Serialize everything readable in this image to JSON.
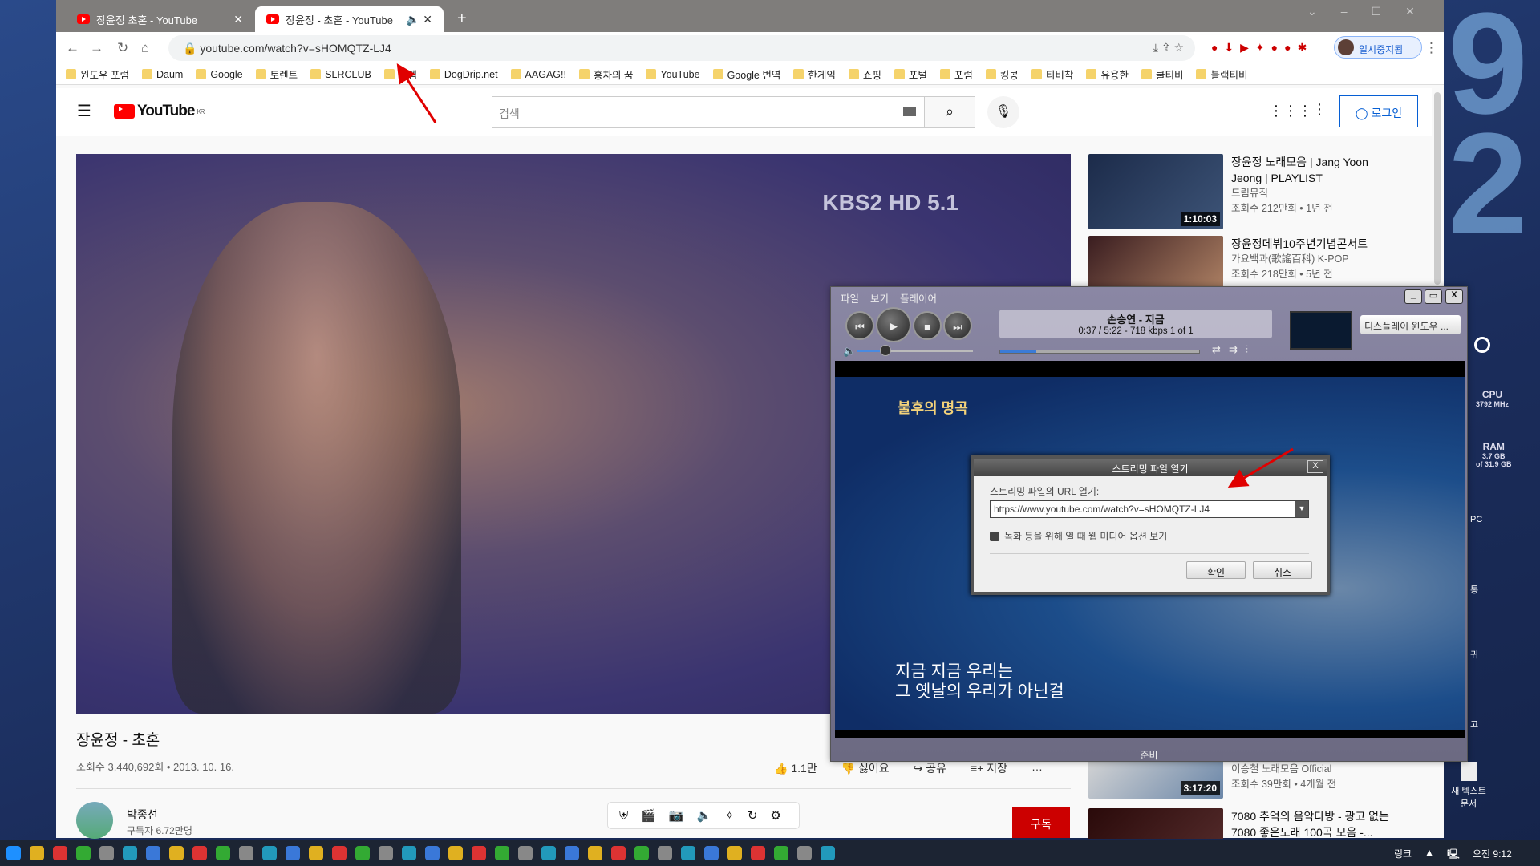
{
  "browser": {
    "tabs": [
      {
        "title": "장윤정 초혼 - YouTube"
      },
      {
        "title": "장윤정 - 초혼 - YouTube"
      }
    ],
    "url": "youtube.com/watch?v=sHOMQTZ-LJ4",
    "profile_label": "일시중지됨",
    "bookmarks": [
      "윈도우 포럼",
      "Daum",
      "Google",
      "토렌트",
      "SLRCLUB",
      "에펨",
      "DogDrip.net",
      "AAGAG!!",
      "홍차의 꿈",
      "YouTube",
      "Google 번역",
      "한게임",
      "쇼핑",
      "포털",
      "포럼",
      "킹콩",
      "티비착",
      "유용한",
      "쿨티비",
      "블랙티비"
    ]
  },
  "youtube": {
    "logo": "YouTube",
    "region": "KR",
    "search_placeholder": "검색",
    "login_label": "로그인",
    "video": {
      "title": "장윤정 - 초혼",
      "meta": "조회수 3,440,692회 • 2013. 10. 16.",
      "likes": "1.1만",
      "dislike": "싫어요",
      "share": "공유",
      "save": "저장",
      "channel": "박종선",
      "subscribers": "구독자 6.72만명",
      "subscribe": "구독",
      "watermark": "KBS2 HD 5.1"
    },
    "sidebar": [
      {
        "title": "장윤정 노래모음 | Jang Yoon Jeong | PLAYLIST",
        "channel": "드림뮤직",
        "meta": "조회수 212만회 • 1년 전",
        "duration": "1:10:03"
      },
      {
        "title": "장윤정데뷔10주년기념콘서트",
        "channel": "가요백과(歌謠百科) K-POP",
        "meta": "조회수 218만회 • 5년 전"
      },
      {
        "title": "이승철 노래모음 Official",
        "meta": "조회수 39만회 • 4개월 전",
        "duration": "3:17:20"
      },
      {
        "title": "7080 추억의 음악다방 - 광고 없는 7080 좋은노래 100곡 모음 -..."
      }
    ]
  },
  "player": {
    "menu": [
      "파일",
      "보기",
      "플레이어"
    ],
    "track": "손승연 - 지금",
    "time": "0:37 / 5:22 -  718 kbps   1 of 1",
    "progress": 0.18,
    "volume": 0.25,
    "display_btn": "디스플레이 윈도우 ...",
    "status": "준비",
    "lyrics": [
      "지금 지금 우리는",
      "그 옛날의 우리가 아닌걸"
    ],
    "show_logo": "불후의 명곡"
  },
  "dialog": {
    "title": "스트리밍 파일 열기",
    "label": "스트리밍 파일의 URL 열기:",
    "url": "https://www.youtube.com/watch?v=sHOMQTZ-LJ4",
    "checkbox": "녹화 등을 위해 열 때 웹 미디어 옵션 보기",
    "ok": "확인",
    "cancel": "취소"
  },
  "desktop": {
    "clock_digits": "92",
    "cpu_label": "CPU",
    "cpu": "3792 MHz",
    "ram_label": "RAM",
    "ram": "3.7 GB",
    "ram_total": "of 31.9 GB",
    "icons": [
      "PC",
      "통",
      "귀",
      "고",
      "새 텍스트 문서"
    ]
  },
  "taskbar": {
    "links": "링크",
    "time": "오전 9:12"
  },
  "colors": {
    "accent": "#065fd4",
    "youtube_red": "#ff0000",
    "subscribe": "#cc0000",
    "arrow": "#e00000"
  }
}
